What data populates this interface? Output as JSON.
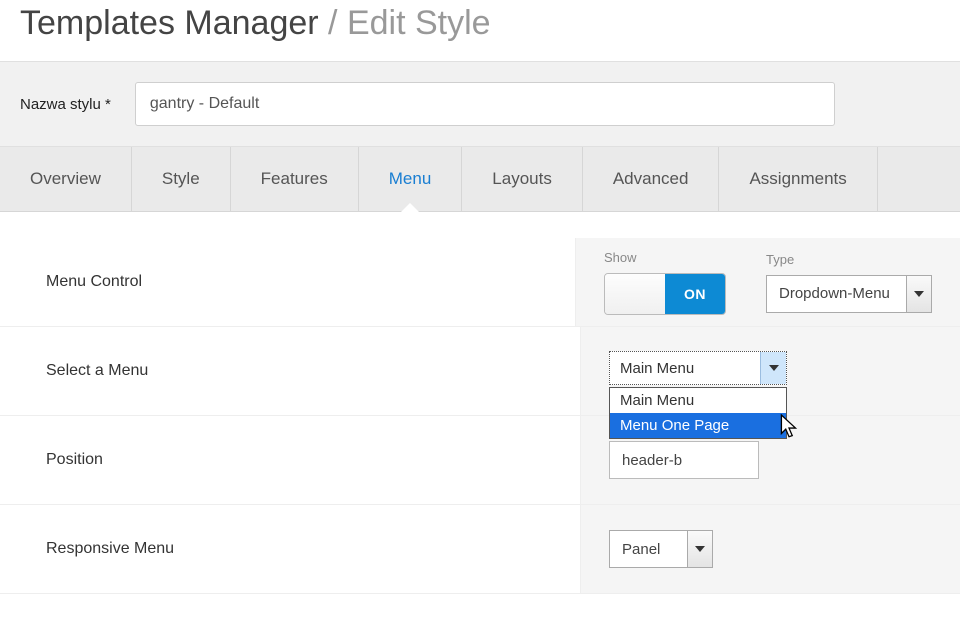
{
  "header": {
    "title_main": "Templates Manager",
    "title_sep": " / ",
    "title_sub": "Edit Style"
  },
  "style_name": {
    "label": "Nazwa stylu *",
    "value": "gantry - Default"
  },
  "tabs": {
    "overview": "Overview",
    "style": "Style",
    "features": "Features",
    "menu": "Menu",
    "layouts": "Layouts",
    "advanced": "Advanced",
    "assignments": "Assignments"
  },
  "rows": {
    "menu_control": {
      "label": "Menu Control",
      "show_label": "Show",
      "toggle_on": "ON",
      "type_label": "Type",
      "type_value": "Dropdown-Menu"
    },
    "select_menu": {
      "label": "Select a Menu",
      "selected": "Main Menu",
      "options": {
        "opt0": "Main Menu",
        "opt1": "Menu One Page"
      }
    },
    "position": {
      "label": "Position",
      "value": "header-b"
    },
    "responsive": {
      "label": "Responsive Menu",
      "value": "Panel"
    }
  }
}
